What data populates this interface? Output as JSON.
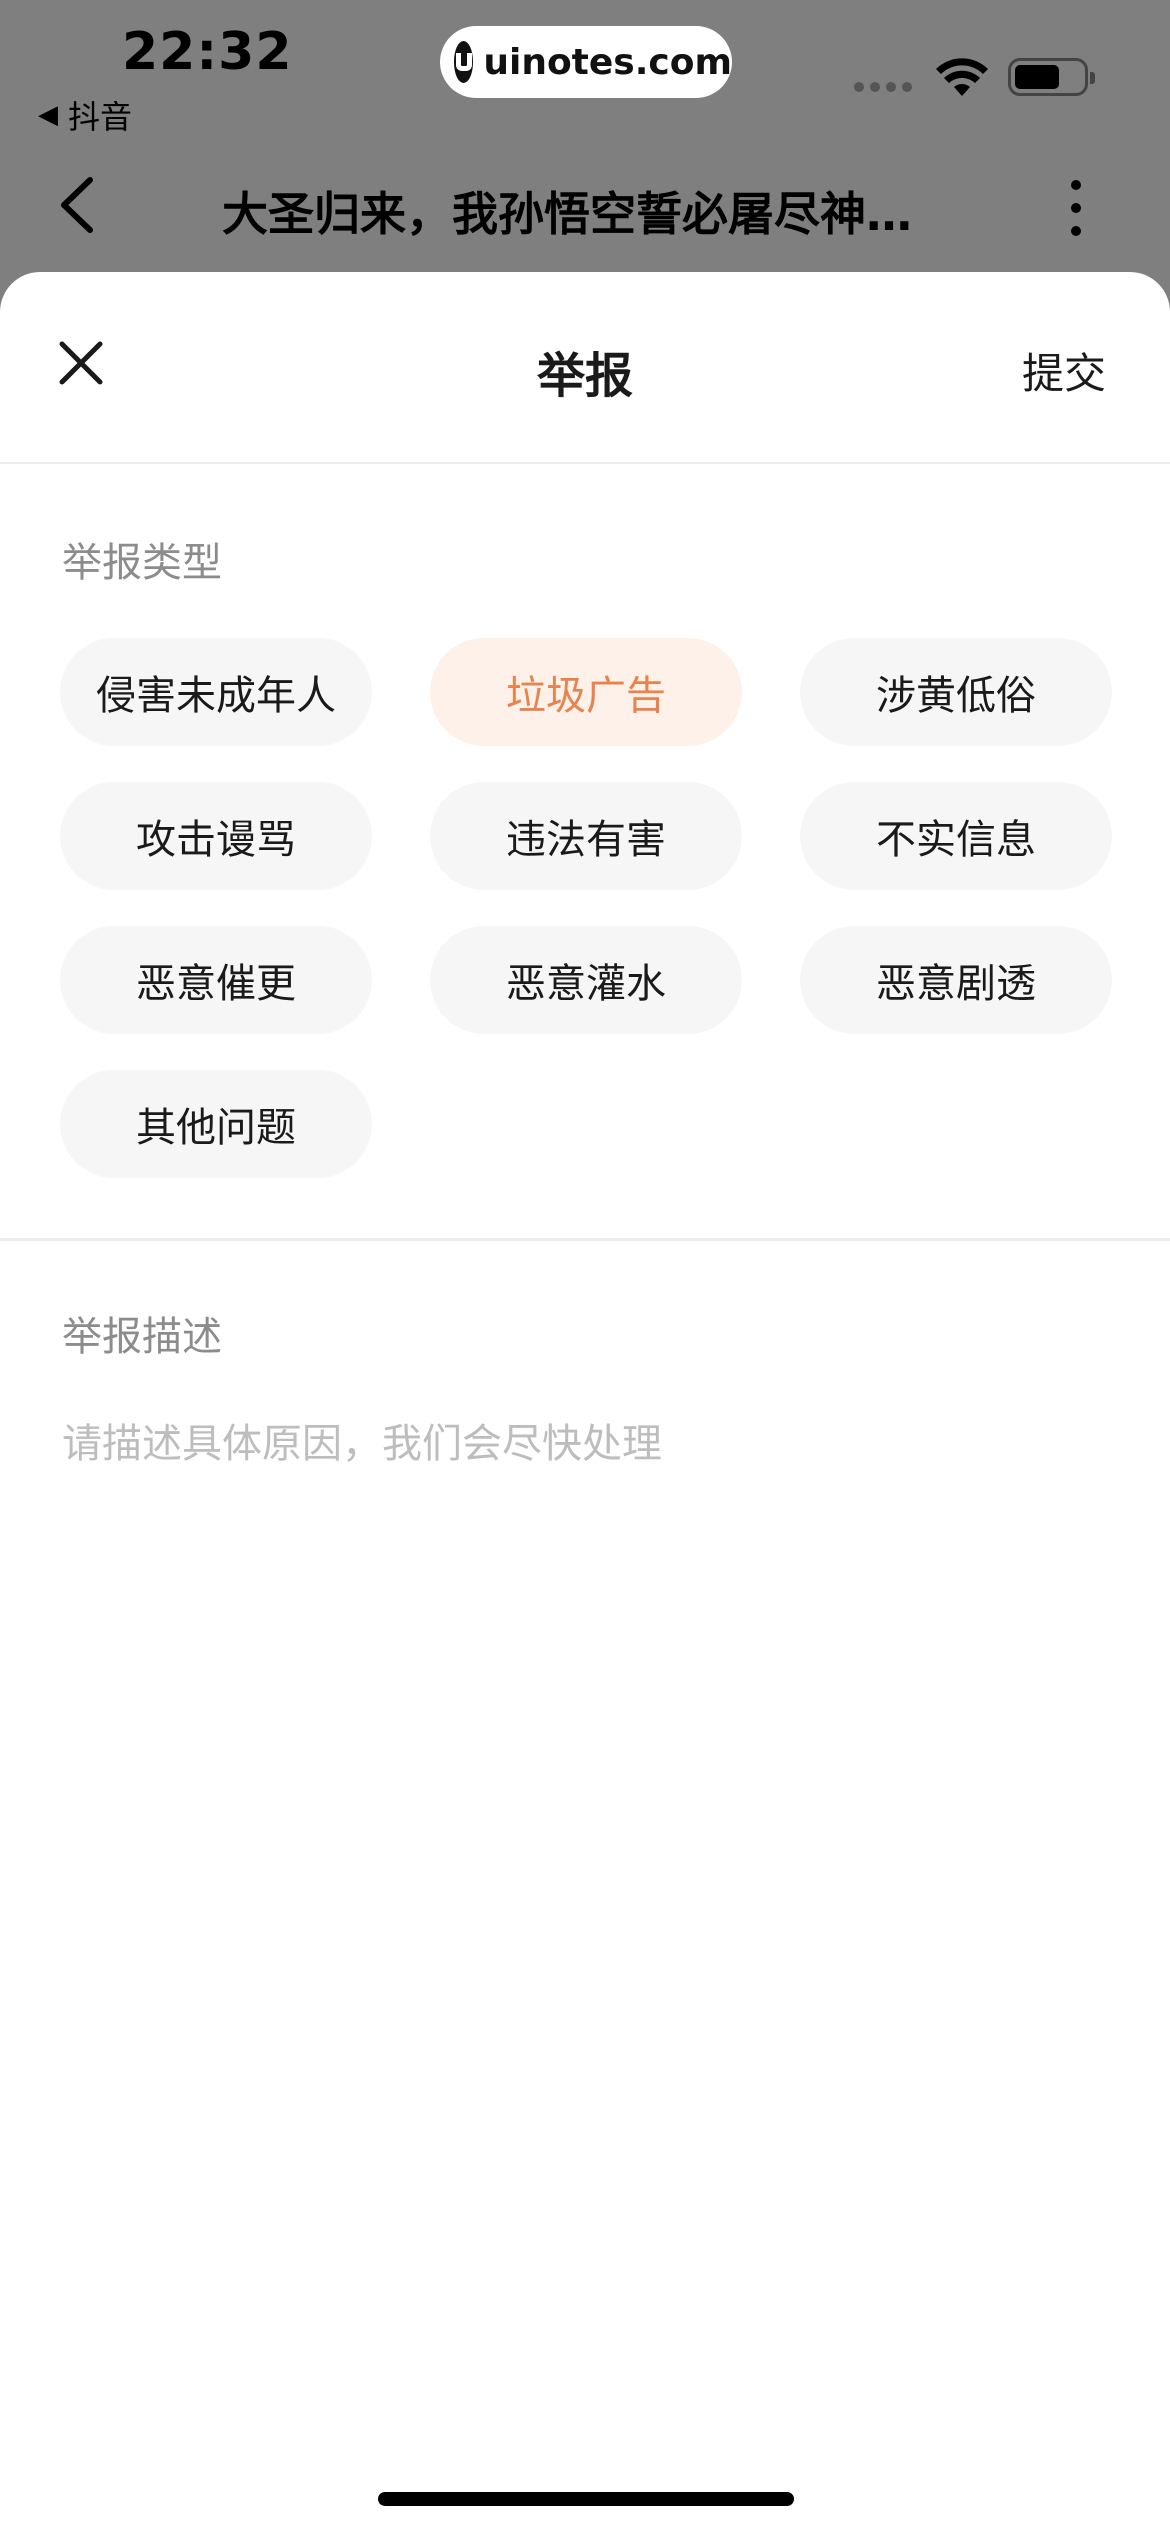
{
  "status_bar": {
    "time": "22:32",
    "back_app": "抖音",
    "back_arrow": "◀",
    "watermark": "uinotes.com"
  },
  "background_page": {
    "title": "大圣归来，我孙悟空誓必屠尽神…"
  },
  "sheet": {
    "title": "举报",
    "submit_label": "提交",
    "type_label": "举报类型",
    "types": [
      {
        "label": "侵害未成年人",
        "selected": false
      },
      {
        "label": "垃圾广告",
        "selected": true
      },
      {
        "label": "涉黄低俗",
        "selected": false
      },
      {
        "label": "攻击谩骂",
        "selected": false
      },
      {
        "label": "违法有害",
        "selected": false
      },
      {
        "label": "不实信息",
        "selected": false
      },
      {
        "label": "恶意催更",
        "selected": false
      },
      {
        "label": "恶意灌水",
        "selected": false
      },
      {
        "label": "恶意剧透",
        "selected": false
      },
      {
        "label": "其他问题",
        "selected": false
      }
    ],
    "desc_label": "举报描述",
    "desc_placeholder": "请描述具体原因，我们会尽快处理",
    "desc_value": ""
  },
  "colors": {
    "accent": "#e8834e",
    "accent_bg": "#fdf1ea",
    "tag_bg": "#f6f6f6",
    "backdrop": "#7f7f7f"
  }
}
